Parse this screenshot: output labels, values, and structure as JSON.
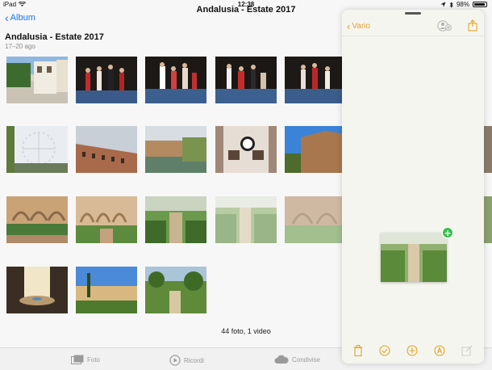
{
  "status": {
    "device": "iPad",
    "time": "12:38",
    "battery": "98%"
  },
  "nav": {
    "back_label": "Album",
    "title": "Andalusia - Estate 2017"
  },
  "album": {
    "title": "Andalusia - Estate 2017",
    "dates": "17–20 ago"
  },
  "summary": "44 foto, 1 video",
  "tabs": [
    {
      "label": "Foto",
      "icon": "photos-icon"
    },
    {
      "label": "Ricordi",
      "icon": "memories-icon"
    },
    {
      "label": "Condivise",
      "icon": "cloud-icon"
    }
  ],
  "notes_panel": {
    "back_label": "Vario",
    "icons": [
      "add-person-icon",
      "share-icon"
    ],
    "toolbar": [
      "trash-icon",
      "checklist-icon",
      "plus-circle-icon",
      "markup-icon",
      "compose-icon"
    ],
    "drop_badge": "+"
  },
  "colors": {
    "accent_blue": "#1a73e8",
    "notes_accent": "#e2a325",
    "add_badge": "#35c24a"
  }
}
